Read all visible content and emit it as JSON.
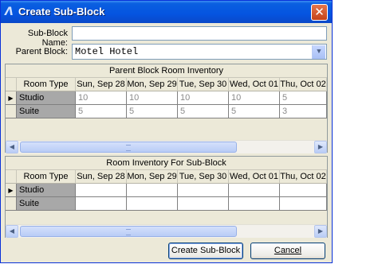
{
  "window": {
    "title": "Create Sub-Block",
    "icon": "app-logo-icon",
    "close_glyph": "✕"
  },
  "form": {
    "subblock_name_label": "Sub-Block Name:",
    "subblock_name_value": "",
    "parent_block_label": "Parent Block:",
    "parent_block_value": "Motel Hotel"
  },
  "columns": [
    "Room Type",
    "Sun, Sep 28",
    "Mon, Sep 29",
    "Tue, Sep 30",
    "Wed, Oct 01",
    "Thu, Oct 02"
  ],
  "parent_inventory": {
    "title": "Parent Block Room Inventory",
    "rows": [
      {
        "type": "Studio",
        "values": [
          "10",
          "10",
          "10",
          "10",
          "5"
        ]
      },
      {
        "type": "Suite",
        "values": [
          "5",
          "5",
          "5",
          "5",
          "3"
        ]
      }
    ]
  },
  "sub_inventory": {
    "title": "Room Inventory For Sub-Block",
    "rows": [
      {
        "type": "Studio",
        "values": [
          "",
          "",
          "",
          "",
          ""
        ]
      },
      {
        "type": "Suite",
        "values": [
          "",
          "",
          "",
          "",
          ""
        ]
      }
    ]
  },
  "buttons": {
    "create": "Create Sub-Block",
    "cancel": "Cancel"
  },
  "glyphs": {
    "row_pointer": "▶",
    "scroll_left": "◀",
    "scroll_right": "▶",
    "dropdown": "▼",
    "grip": "⁞"
  },
  "colors": {
    "title_bar": "#0554e0",
    "window_bg": "#ece9d8",
    "readonly_text": "#8a8a8a"
  }
}
